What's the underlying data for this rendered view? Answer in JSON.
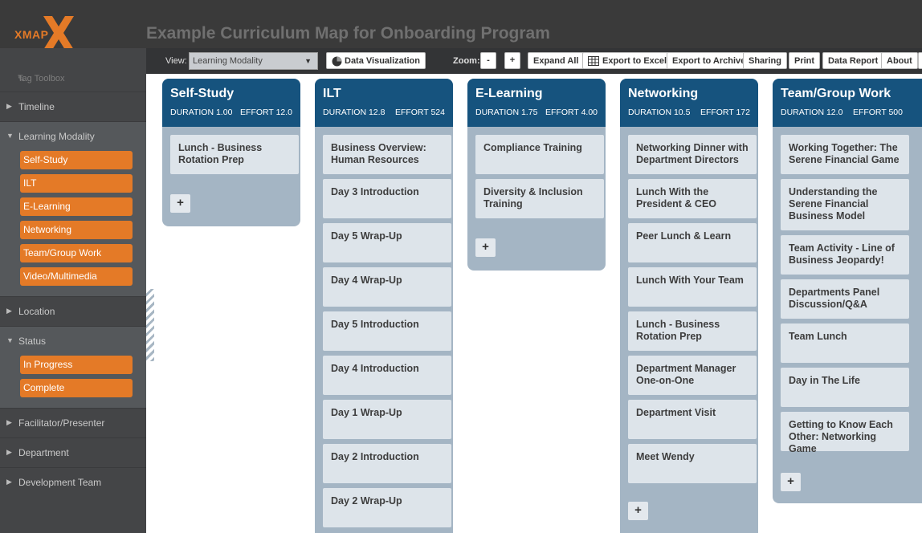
{
  "app": {
    "logo_text": "XMAP",
    "page_title": "Example Curriculum Map for Onboarding Program",
    "colors": {
      "accent": "#e47a27",
      "column_header": "#16537e",
      "column_body": "#a4b5c4",
      "card": "#dde4ea"
    }
  },
  "sidebar": {
    "tag_toolbox": "Tag Toolbox",
    "sections": [
      {
        "label": "Timeline"
      },
      {
        "label": "Learning Modality",
        "tags": [
          "Self-Study",
          "ILT",
          "E-Learning",
          "Networking",
          "Team/Group Work",
          "Video/Multimedia"
        ]
      },
      {
        "label": "Location"
      },
      {
        "label": "Status",
        "tags": [
          "In Progress",
          "Complete"
        ]
      },
      {
        "label": "Facilitator/Presenter"
      },
      {
        "label": "Department"
      },
      {
        "label": "Development Team"
      }
    ]
  },
  "toolbar": {
    "view_label": "View:",
    "view_value": "Learning Modality",
    "data_visualization": "Data Visualization",
    "zoom_label": "Zoom:",
    "zoom_out": "-",
    "zoom_in": "+",
    "expand_all": "Expand All",
    "export_excel": "Export to Excel",
    "export_archive": "Export to Archive",
    "sharing": "Sharing",
    "print": "Print",
    "data_report": "Data Report",
    "about": "About"
  },
  "columns": [
    {
      "title": "Self-Study",
      "duration": "DURATION 1.00",
      "effort": "EFFORT 12.0",
      "add": "+",
      "cards": [
        "Lunch - Business Rotation Prep"
      ]
    },
    {
      "title": "ILT",
      "duration": "DURATION 12.8",
      "effort": "EFFORT 524",
      "add": "+",
      "cards": [
        "Business Overview: Human Resources",
        "Day 3 Introduction",
        "Day 5 Wrap-Up",
        "Day 4 Wrap-Up",
        "Day 5 Introduction",
        "Day 4 Introduction",
        "Day 1 Wrap-Up",
        "Day 2 Introduction",
        "Day 2 Wrap-Up"
      ]
    },
    {
      "title": "E-Learning",
      "duration": "DURATION 1.75",
      "effort": "EFFORT 4.00",
      "add": "+",
      "cards": [
        "Compliance Training",
        "Diversity & Inclusion Training"
      ]
    },
    {
      "title": "Networking",
      "duration": "DURATION 10.5",
      "effort": "EFFORT 172",
      "add": "+",
      "cards": [
        "Networking Dinner with Department Directors",
        "Lunch With the President & CEO",
        "Peer Lunch & Learn",
        "Lunch With Your Team",
        "Lunch - Business Rotation Prep",
        "Department Manager One-on-One",
        "Department Visit",
        "Meet Wendy"
      ]
    },
    {
      "title": "Team/Group Work",
      "duration": "DURATION 12.0",
      "effort": "EFFORT 500",
      "add": "+",
      "cards": [
        "Working Together: The Serene Financial Game",
        "Understanding the Serene Financial Business Model",
        "Team Activity - Line of Business Jeopardy!",
        "Departments Panel Discussion/Q&A",
        "Team Lunch",
        "Day in The Life",
        "Getting to Know Each Other: Networking Game"
      ]
    }
  ]
}
